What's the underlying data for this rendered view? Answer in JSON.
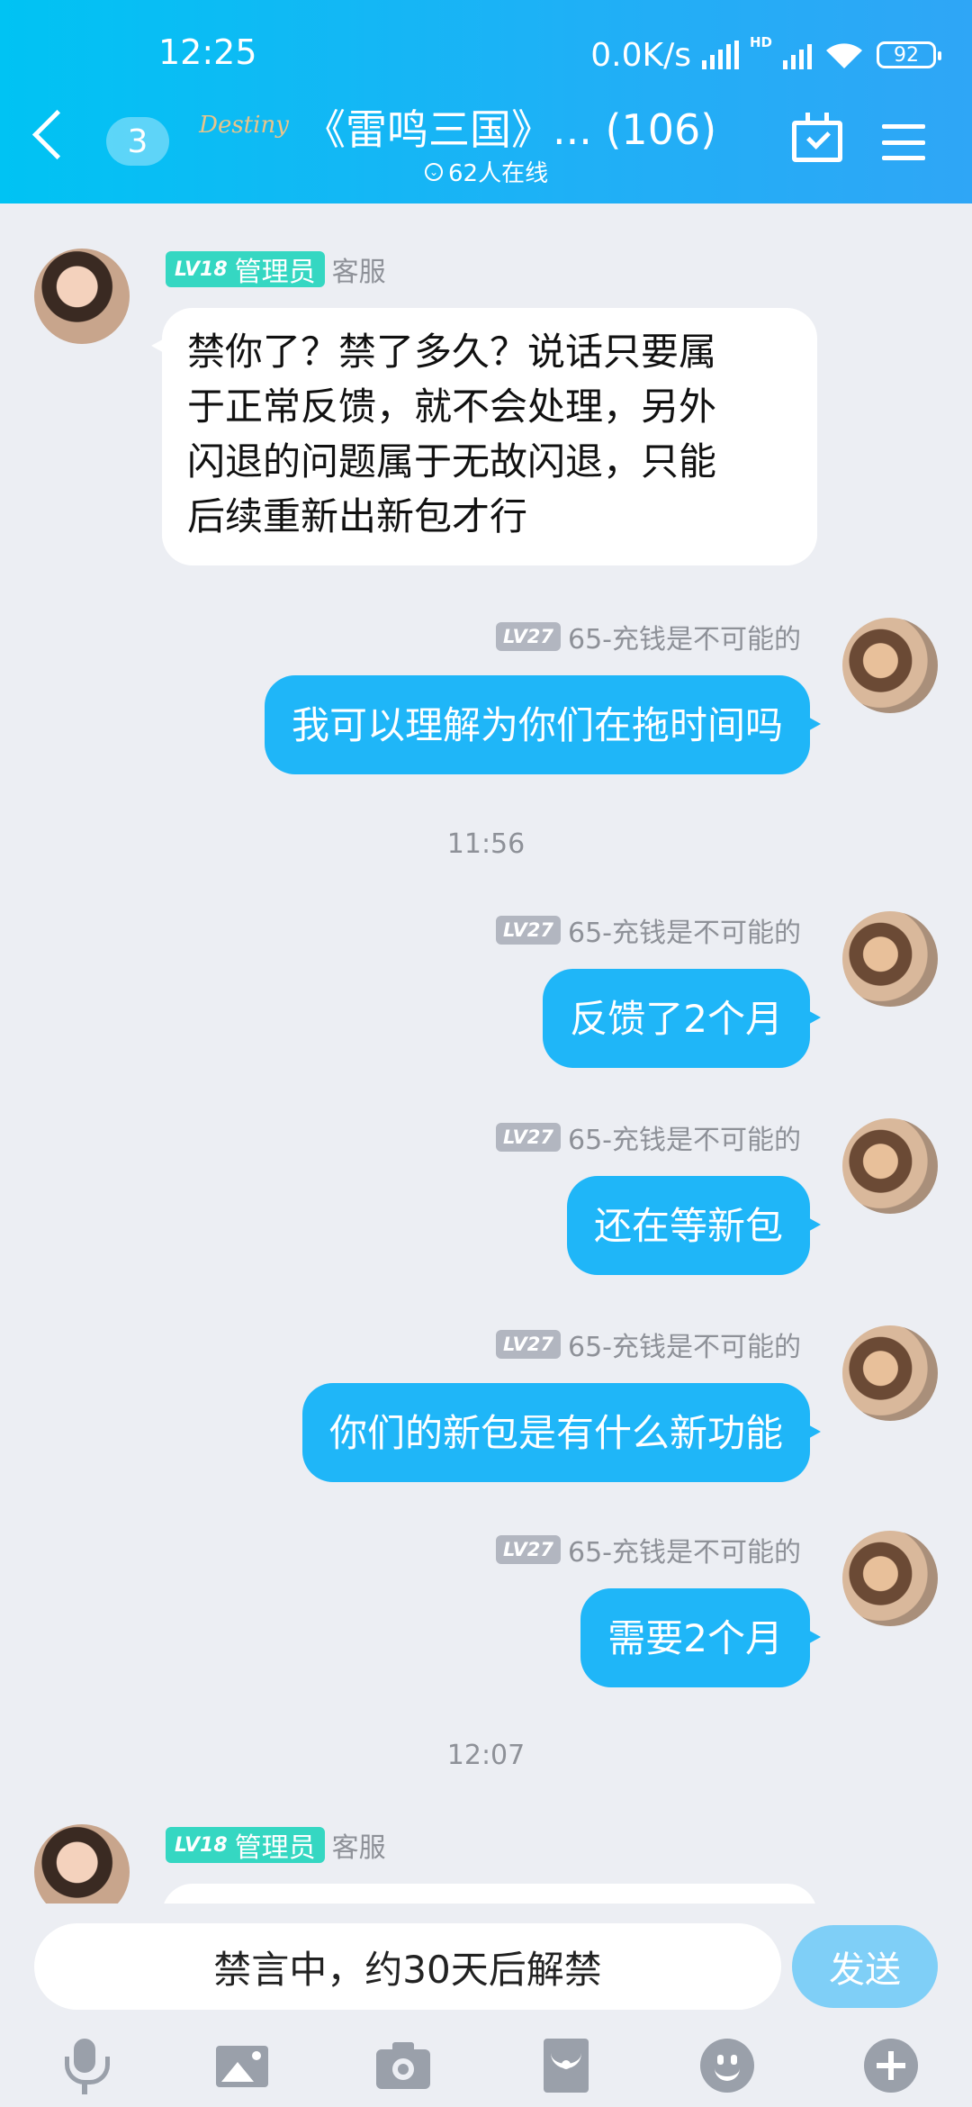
{
  "status_bar": {
    "time": "12:25",
    "net_speed": "0.0K/s",
    "hd": "HD",
    "battery": "92"
  },
  "header": {
    "unread": "3",
    "logo_text": "Destiny",
    "title": "《雷鸣三国》... (106)",
    "online_count": "62人在线"
  },
  "messages": [
    {
      "level": "LV18",
      "role": "管理员",
      "name": "客服",
      "lines": [
        "禁你了？禁了多久？说话只要属",
        "于正常反馈，就不会处理，另外",
        "闪退的问题属于无故闪退，只能",
        "后续重新出新包才行"
      ]
    },
    {
      "level": "LV27",
      "name": "65-充钱是不可能的",
      "text": "我可以理解为你们在拖时间吗"
    },
    {
      "time": "11:56"
    },
    {
      "level": "LV27",
      "name": "65-充钱是不可能的",
      "text": "反馈了2个月"
    },
    {
      "level": "LV27",
      "name": "65-充钱是不可能的",
      "text": "还在等新包"
    },
    {
      "level": "LV27",
      "name": "65-充钱是不可能的",
      "text": "你们的新包是有什么新功能"
    },
    {
      "level": "LV27",
      "name": "65-充钱是不可能的",
      "text": "需要2个月"
    },
    {
      "time": "12:07"
    },
    {
      "level": "LV18",
      "role": "管理员",
      "name": "客服"
    }
  ],
  "input": {
    "status_text": "禁言中，约30天后解禁",
    "send_label": "发送"
  },
  "toolbar_icons": [
    "mic-icon",
    "image-icon",
    "camera-icon",
    "red-packet-icon",
    "emoji-icon",
    "plus-icon"
  ]
}
